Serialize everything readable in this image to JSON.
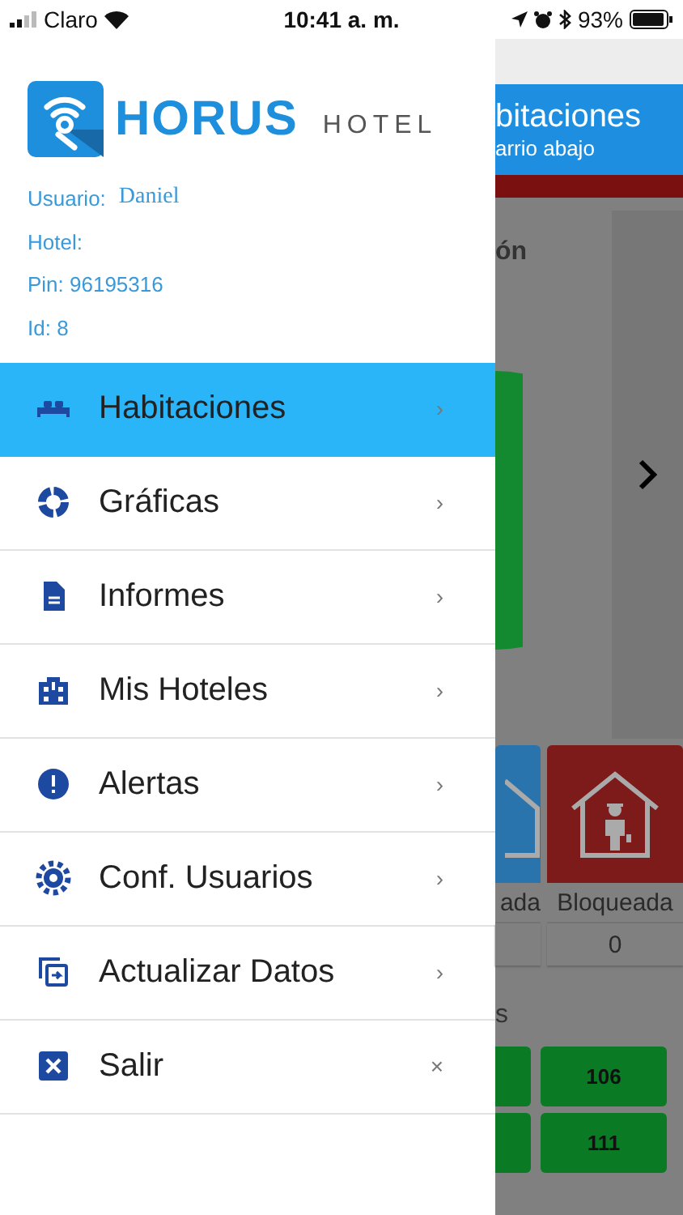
{
  "status_bar": {
    "carrier": "Claro",
    "time": "10:41 a. m.",
    "battery": "93%"
  },
  "drawer": {
    "logo": {
      "brand": "HORUS",
      "sub": "HOTEL"
    },
    "info": [
      {
        "label": "Usuario:",
        "value": "Daniel"
      },
      {
        "label": "Hotel:"
      },
      {
        "label": "Pin: 96195316"
      },
      {
        "label": "Id: 8"
      }
    ],
    "menu": [
      {
        "label": "Habitaciones",
        "kind": "bed",
        "trailing": "›",
        "selected": true
      },
      {
        "label": "Gráficas",
        "kind": "donut",
        "trailing": "›",
        "selected": false
      },
      {
        "label": "Informes",
        "kind": "document",
        "trailing": "›",
        "selected": false
      },
      {
        "label": "Mis Hoteles",
        "kind": "building",
        "trailing": "›",
        "selected": false
      },
      {
        "label": "Alertas",
        "kind": "alert",
        "trailing": "›",
        "selected": false
      },
      {
        "label": "Conf. Usuarios",
        "kind": "gear",
        "trailing": "›",
        "selected": false
      },
      {
        "label": "Actualizar Datos",
        "kind": "refresh",
        "trailing": "›",
        "selected": false
      },
      {
        "label": "Salir",
        "kind": "exit",
        "trailing": "×",
        "selected": false
      }
    ]
  },
  "background": {
    "title": "bitaciones",
    "subtitle": "arrio abajo",
    "section_title": "ón",
    "tiles": [
      {
        "kind": "blue",
        "label": "ada"
      },
      {
        "kind": "red",
        "label": "Bloqueada",
        "count": "0"
      }
    ],
    "rooms_title": "s",
    "rooms": [
      "106",
      "111"
    ]
  }
}
